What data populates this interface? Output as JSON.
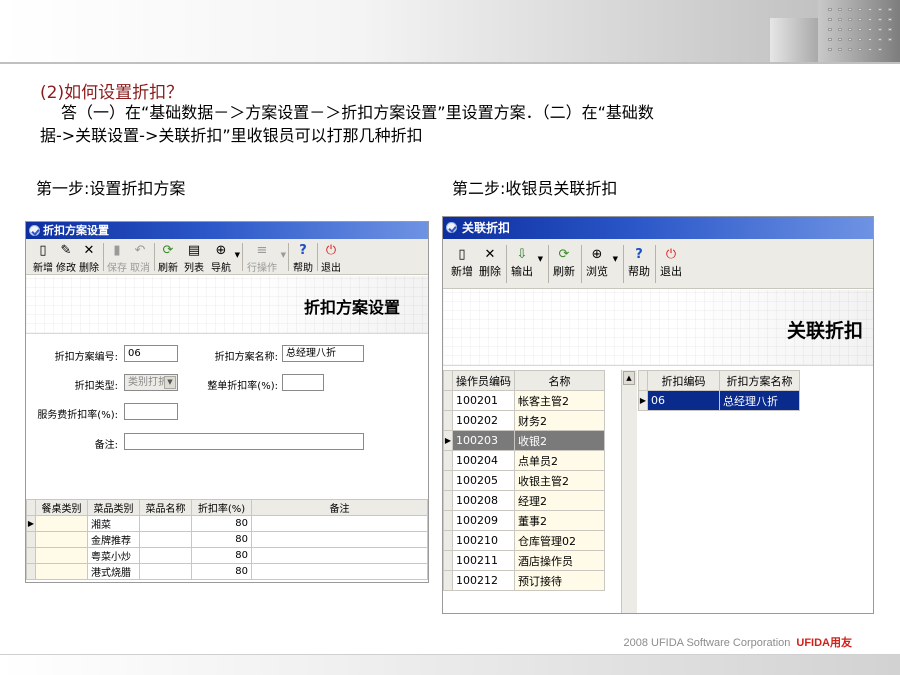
{
  "slide": {
    "question": "(2)如何设置折扣？",
    "answer_line1": "答（一）在“基础数据－＞方案设置－＞折扣方案设置”里设置方案．（二）在“基础数",
    "answer_line2": "据->关联设置->关联折扣”里收银员可以打那几种折扣",
    "step1": "第一步:设置折扣方案",
    "step2": "第二步:收银员关联折扣",
    "footer": "2008 UFIDA Software Corporation",
    "brand": "UFIDA",
    "brand_cn": "用友"
  },
  "window1": {
    "title": "折扣方案设置",
    "banner": "折扣方案设置",
    "toolbar": [
      {
        "label": "新增",
        "icon": "▯",
        "enabled": true
      },
      {
        "label": "修改",
        "icon": "✎",
        "enabled": true
      },
      {
        "label": "删除",
        "icon": "✕",
        "enabled": true
      },
      {
        "label": "保存",
        "icon": "▮",
        "enabled": false
      },
      {
        "label": "取消",
        "icon": "↶",
        "enabled": false
      },
      {
        "label": "刷新",
        "icon": "⟳",
        "enabled": true
      },
      {
        "label": "列表",
        "icon": "▤",
        "enabled": true
      },
      {
        "label": "导航",
        "icon": "⊕",
        "enabled": true
      },
      {
        "label": "行操作",
        "icon": "≡",
        "enabled": false
      },
      {
        "label": "帮助",
        "icon": "?",
        "enabled": true
      },
      {
        "label": "退出",
        "icon": "⏻",
        "enabled": true
      }
    ],
    "form": {
      "code_label": "折扣方案编号:",
      "code_value": "06",
      "name_label": "折扣方案名称:",
      "name_value": "总经理八折",
      "type_label": "折扣类型:",
      "type_value": "类别打折",
      "whole_label": "整单折扣率(%):",
      "whole_value": "",
      "service_label": "服务费折扣率(%):",
      "service_value": "",
      "note_label": "备注:",
      "note_value": ""
    },
    "grid": {
      "headers": [
        "餐桌类别",
        "菜品类别",
        "菜品名称",
        "折扣率(%)",
        "备注"
      ],
      "rows": [
        {
          "table_type": "",
          "dish_type": "湘菜",
          "dish_name": "",
          "rate": "80",
          "note": ""
        },
        {
          "table_type": "",
          "dish_type": "金牌推荐",
          "dish_name": "",
          "rate": "80",
          "note": ""
        },
        {
          "table_type": "",
          "dish_type": "粤菜小炒",
          "dish_name": "",
          "rate": "80",
          "note": ""
        },
        {
          "table_type": "",
          "dish_type": "港式烧腊",
          "dish_name": "",
          "rate": "80",
          "note": ""
        }
      ]
    }
  },
  "window2": {
    "title": "关联折扣",
    "banner": "关联折扣",
    "toolbar": [
      {
        "label": "新增",
        "icon": "▯",
        "enabled": true
      },
      {
        "label": "删除",
        "icon": "✕",
        "enabled": true
      },
      {
        "label": "输出",
        "icon": "⇩",
        "enabled": true
      },
      {
        "label": "刷新",
        "icon": "⟳",
        "enabled": true
      },
      {
        "label": "浏览",
        "icon": "⊕",
        "enabled": true
      },
      {
        "label": "帮助",
        "icon": "?",
        "enabled": true
      },
      {
        "label": "退出",
        "icon": "⏻",
        "enabled": true
      }
    ],
    "operators": {
      "headers": [
        "操作员编码",
        "名称"
      ],
      "rows": [
        {
          "code": "100201",
          "name": "帐客主管2"
        },
        {
          "code": "100202",
          "name": "财务2"
        },
        {
          "code": "100203",
          "name": "收银2"
        },
        {
          "code": "100204",
          "name": "点单员2"
        },
        {
          "code": "100205",
          "name": "收银主管2"
        },
        {
          "code": "100208",
          "name": "经理2"
        },
        {
          "code": "100209",
          "name": "董事2"
        },
        {
          "code": "100210",
          "name": "仓库管理02"
        },
        {
          "code": "100211",
          "name": "酒店操作员"
        },
        {
          "code": "100212",
          "name": "预订接待"
        }
      ]
    },
    "discounts": {
      "headers": [
        "折扣编码",
        "折扣方案名称"
      ],
      "rows": [
        {
          "code": "06",
          "name": "总经理八折"
        }
      ]
    }
  }
}
